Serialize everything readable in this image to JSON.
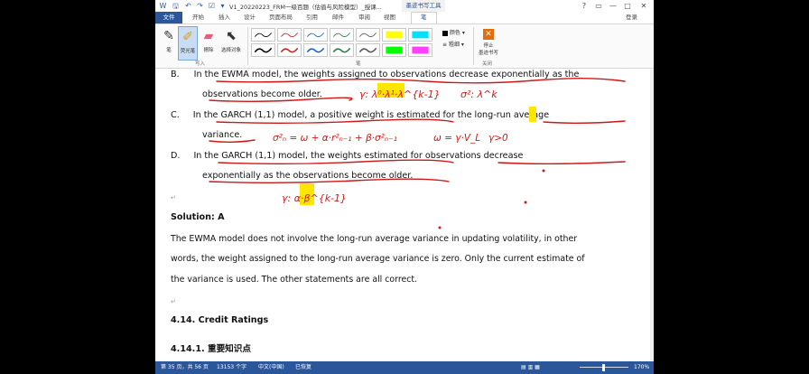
{
  "titlebar": {
    "app_icon": "word-icon",
    "quick_access": [
      "save-icon",
      "undo-icon",
      "redo-icon",
      "checkbox-icon",
      "customize-icon"
    ],
    "doc_title": "V1_20220223_FRM一级百题（估值与风险模型）_授课...",
    "ink_tools_label": "墨迹书写工具",
    "window_controls": [
      "?",
      "▭",
      "—",
      "□",
      "✕"
    ]
  },
  "tabs": {
    "file": "文件",
    "items": [
      "开始",
      "插入",
      "设计",
      "页面布局",
      "引用",
      "邮件",
      "审阅",
      "视图"
    ],
    "active": "笔",
    "login": "登录"
  },
  "ribbon": {
    "write_group": {
      "label": "写入",
      "tools": [
        {
          "label": "笔",
          "icon": "pen-icon",
          "active": false
        },
        {
          "label": "荧光笔",
          "icon": "highlighter-icon",
          "active": true
        },
        {
          "label": "擦除",
          "icon": "eraser-icon",
          "active": false
        },
        {
          "label": "选择对象",
          "icon": "select-cursor-icon",
          "active": false
        }
      ]
    },
    "pens_group": {
      "label": "笔",
      "pens": [
        "#000000",
        "#d02020",
        "#2060c0",
        "#208040",
        "#555555",
        "#000000",
        "#d02020",
        "#2060c0",
        "#208040",
        "#555555"
      ],
      "highlighters": [
        "#ffff00",
        "#00e0ff",
        "#00ff00",
        "#ff40ff"
      ]
    },
    "color_label": "颜色",
    "thickness_label": "粗细",
    "close_group": {
      "label": "关闭",
      "stop_label_1": "停止",
      "stop_label_2": "墨迹书写"
    }
  },
  "document": {
    "option_b": {
      "letter": "B.",
      "line1": "In the EWMA model, the weights assigned to observations decrease exponentially as the",
      "line2": "observations become older."
    },
    "option_c": {
      "letter": "C.",
      "line1": "In the GARCH (1,1) model, a positive weight is estimated for the long-run average",
      "line2": "variance."
    },
    "option_d": {
      "letter": "D.",
      "line1": "In the GARCH (1,1) model, the weights estimated for observations decrease",
      "line2": "exponentially as the observations become older."
    },
    "solution_heading": "Solution: A",
    "solution_lines": [
      "The EWMA model does not involve the long-run average variance in updating volatility, in other",
      "words, the weight assigned to the long-run average variance is zero. Only the current estimate of",
      "the variance is used. The other statements are all correct."
    ],
    "section_heading": "4.14.   Credit Ratings",
    "subsection_heading": "4.14.1.   重要知识点",
    "para_mark": "↵"
  },
  "handwriting": {
    "ewma_weight": "γ: λ⁰·λ¹·λ^{k-1}",
    "ewma_sigma": "σ²: λ^k",
    "garch_formula": "σ²ₙ = ω + α·r²ₙ₋₁ + β·σ²ₙ₋₁",
    "garch_omega": "ω = γ·V_L",
    "gamma_positive": "γ>0",
    "garch_weight": "γ: α·β^{k-1}"
  },
  "statusbar": {
    "page": "第 35 页，共 56 页",
    "words": "13153 个字",
    "language": "中文(中国)",
    "state": "已恢复",
    "zoom": "170%"
  },
  "colors": {
    "word_blue": "#2b579a",
    "ink_red": "#d01818",
    "highlight_yellow": "#ffe600"
  }
}
